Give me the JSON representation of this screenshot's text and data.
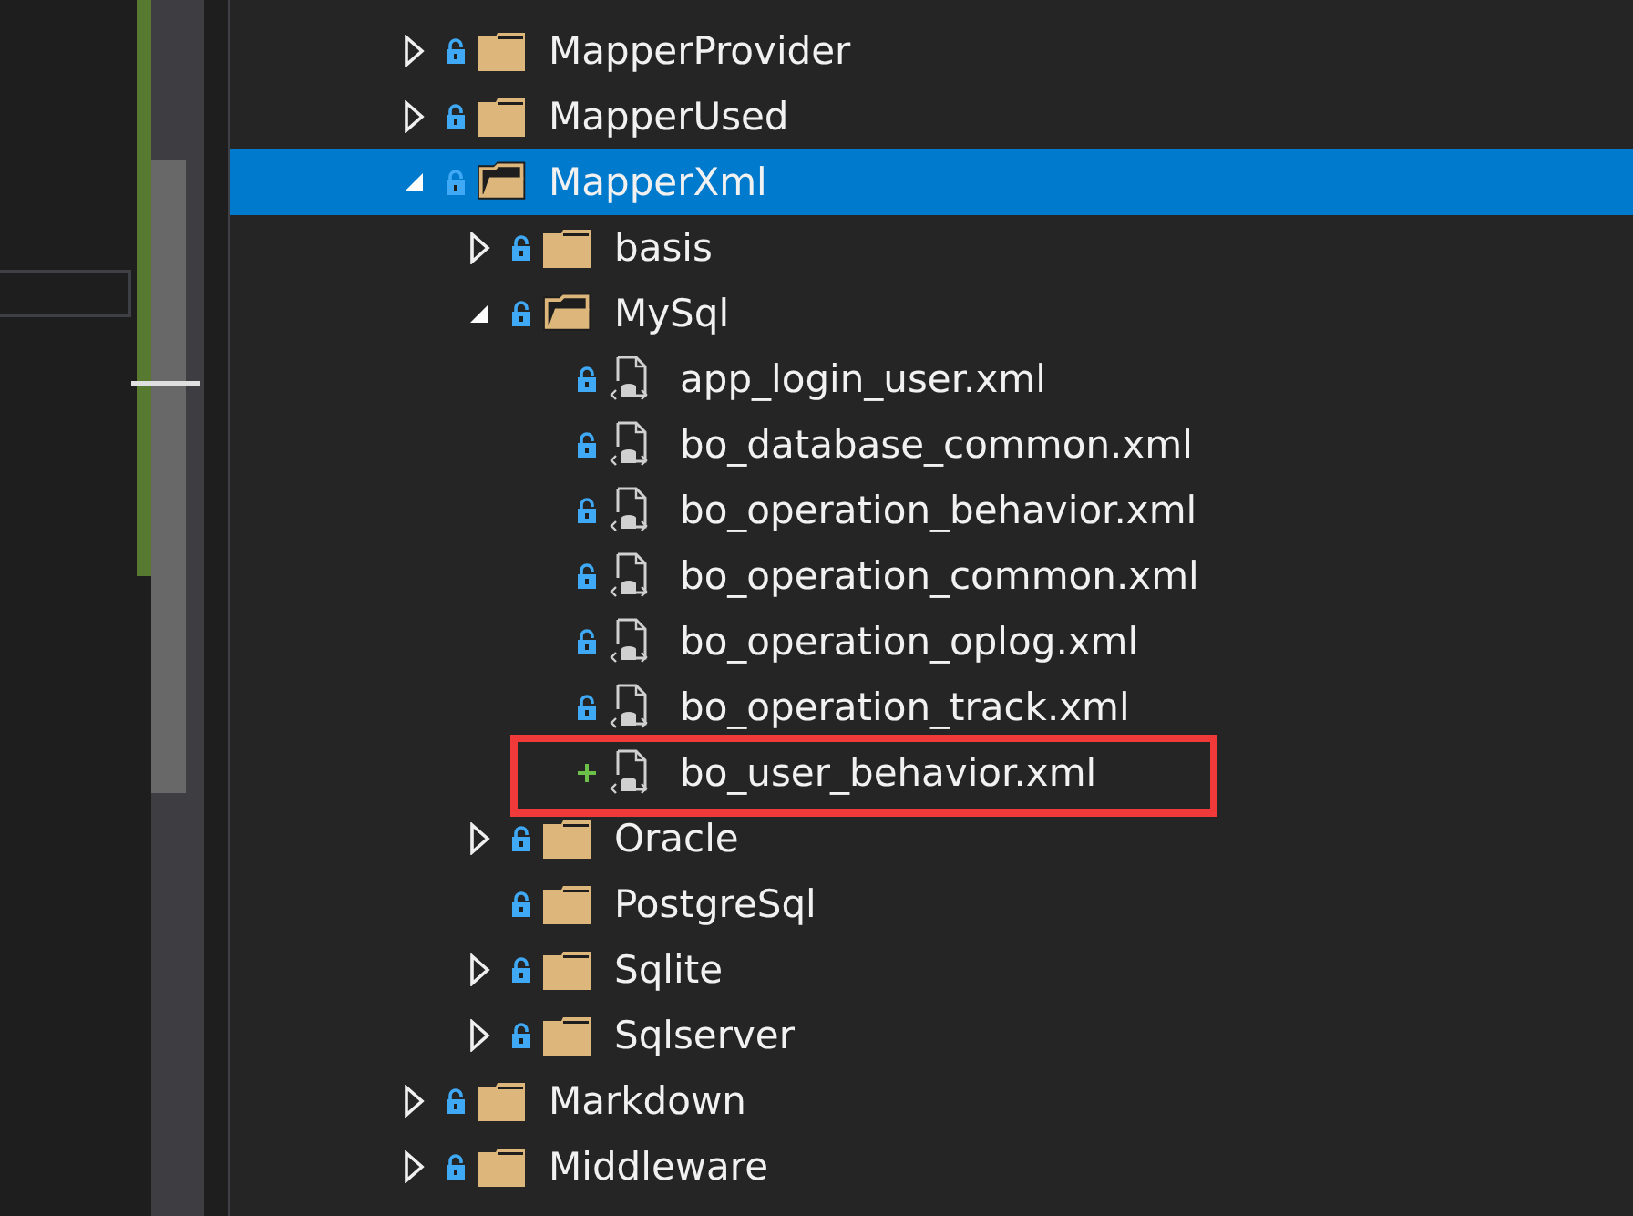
{
  "solution_explorer": {
    "items": [
      {
        "kind": "folder",
        "name": "MapperProvider",
        "pending_add": false,
        "expandable": true,
        "expanded": false,
        "selected": false
      },
      {
        "kind": "folder",
        "name": "MapperUsed",
        "pending_add": false,
        "expandable": true,
        "expanded": false,
        "selected": false
      },
      {
        "kind": "folder",
        "name": "MapperXml",
        "pending_add": false,
        "expandable": true,
        "expanded": true,
        "selected": true,
        "children": [
          {
            "kind": "folder",
            "name": "basis",
            "pending_add": false,
            "expandable": true,
            "expanded": false,
            "selected": false
          },
          {
            "kind": "folder",
            "name": "MySql",
            "pending_add": false,
            "expandable": true,
            "expanded": true,
            "selected": false,
            "children": [
              {
                "kind": "file",
                "name": "app_login_user.xml",
                "pending_add": false,
                "selected": false
              },
              {
                "kind": "file",
                "name": "bo_database_common.xml",
                "pending_add": false,
                "selected": false
              },
              {
                "kind": "file",
                "name": "bo_operation_behavior.xml",
                "pending_add": false,
                "selected": false
              },
              {
                "kind": "file",
                "name": "bo_operation_common.xml",
                "pending_add": false,
                "selected": false
              },
              {
                "kind": "file",
                "name": "bo_operation_oplog.xml",
                "pending_add": false,
                "selected": false
              },
              {
                "kind": "file",
                "name": "bo_operation_track.xml",
                "pending_add": false,
                "selected": false
              },
              {
                "kind": "file",
                "name": "bo_user_behavior.xml",
                "pending_add": true,
                "selected": false,
                "highlighted": true
              }
            ]
          },
          {
            "kind": "folder",
            "name": "Oracle",
            "pending_add": false,
            "expandable": true,
            "expanded": false,
            "selected": false
          },
          {
            "kind": "folder",
            "name": "PostgreSql",
            "pending_add": false,
            "expandable": false,
            "selected": false
          },
          {
            "kind": "folder",
            "name": "Sqlite",
            "pending_add": false,
            "expandable": true,
            "expanded": false,
            "selected": false
          },
          {
            "kind": "folder",
            "name": "Sqlserver",
            "pending_add": false,
            "expandable": true,
            "expanded": false,
            "selected": false
          }
        ]
      },
      {
        "kind": "folder",
        "name": "Markdown",
        "pending_add": false,
        "expandable": true,
        "expanded": false,
        "selected": false
      },
      {
        "kind": "folder",
        "name": "Middleware",
        "pending_add": false,
        "expandable": true,
        "expanded": false,
        "selected": false
      }
    ]
  }
}
